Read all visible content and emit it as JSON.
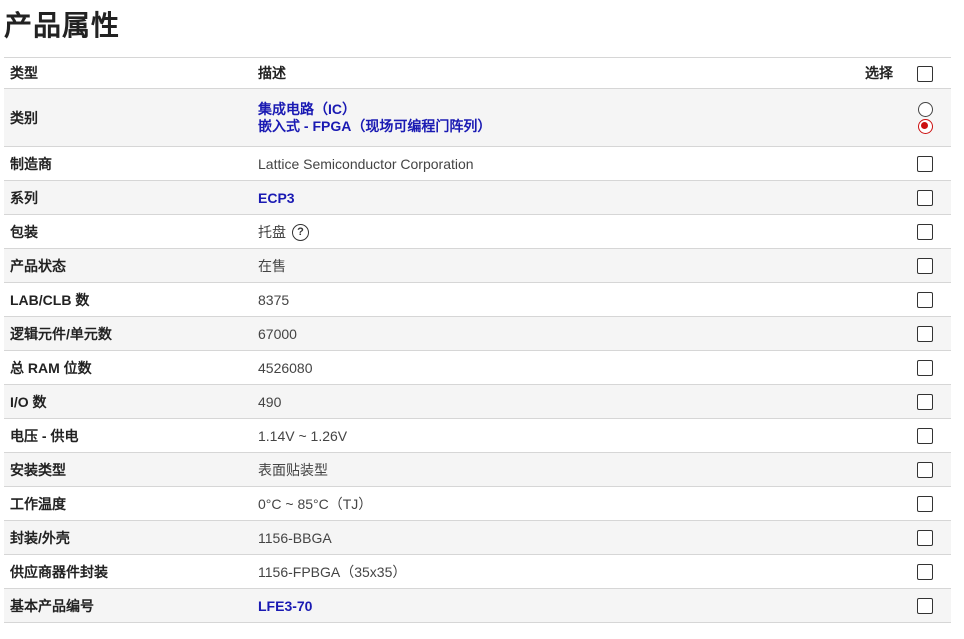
{
  "title": "产品属性",
  "header": {
    "type": "类型",
    "description": "描述",
    "select": "选择"
  },
  "rows": [
    {
      "name": "类别",
      "values": [
        "集成电路（IC）",
        "嵌入式 - FPGA（现场可编程门阵列）"
      ]
    },
    {
      "name": "制造商",
      "value": "Lattice Semiconductor Corporation"
    },
    {
      "name": "系列",
      "value": "ECP3"
    },
    {
      "name": "包装",
      "value": "托盘"
    },
    {
      "name": "产品状态",
      "value": "在售"
    },
    {
      "name": "LAB/CLB 数",
      "value": "8375"
    },
    {
      "name": "逻辑元件/单元数",
      "value": "67000"
    },
    {
      "name": "总 RAM 位数",
      "value": "4526080"
    },
    {
      "name": "I/O 数",
      "value": "490"
    },
    {
      "name": "电压 - 供电",
      "value": "1.14V ~ 1.26V"
    },
    {
      "name": "安装类型",
      "value": "表面贴装型"
    },
    {
      "name": "工作温度",
      "value": "0°C ~ 85°C（TJ）"
    },
    {
      "name": "封装/外壳",
      "value": "1156-BBGA"
    },
    {
      "name": "供应商器件封装",
      "value": "1156-FPBGA（35x35）"
    },
    {
      "name": "基本产品编号",
      "value": "LFE3-70"
    }
  ],
  "help_icon_glyph": "?",
  "colors": {
    "link": "#1a1ab3",
    "radio_checked": "#cc1111",
    "row_alt": "#f5f5f5"
  }
}
